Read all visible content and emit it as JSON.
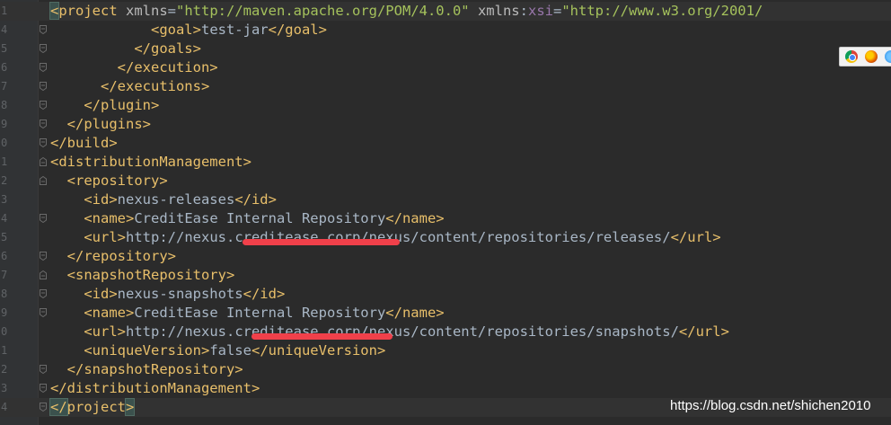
{
  "editor": {
    "lines": [
      {
        "num": "1",
        "parts": [
          {
            "t": "<",
            "c": "tag bm"
          },
          {
            "t": "project",
            "c": "tag"
          },
          {
            "t": " xmlns",
            "c": "attr"
          },
          {
            "t": "=",
            "c": "txt"
          },
          {
            "t": "\"http://maven.apache.org/POM/4.0.0\"",
            "c": "val"
          },
          {
            "t": " xmlns",
            "c": "attr"
          },
          {
            "t": ":",
            "c": "txt"
          },
          {
            "t": "xsi",
            "c": "ns"
          },
          {
            "t": "=",
            "c": "txt"
          },
          {
            "t": "\"http://www.w3.org/2001/",
            "c": "val"
          }
        ]
      },
      {
        "num": "4",
        "parts": [
          {
            "t": "            <goal>",
            "c": "tag"
          },
          {
            "t": "test-jar",
            "c": "txt"
          },
          {
            "t": "</goal>",
            "c": "tag"
          }
        ]
      },
      {
        "num": "5",
        "parts": [
          {
            "t": "          </goals>",
            "c": "tag"
          }
        ]
      },
      {
        "num": "6",
        "parts": [
          {
            "t": "        </execution>",
            "c": "tag"
          }
        ]
      },
      {
        "num": "7",
        "parts": [
          {
            "t": "      </executions>",
            "c": "tag"
          }
        ]
      },
      {
        "num": "8",
        "parts": [
          {
            "t": "    </plugin>",
            "c": "tag"
          }
        ]
      },
      {
        "num": "9",
        "parts": [
          {
            "t": "  </plugins>",
            "c": "tag"
          }
        ]
      },
      {
        "num": "0",
        "parts": [
          {
            "t": "</build>",
            "c": "tag"
          }
        ]
      },
      {
        "num": "1",
        "parts": [
          {
            "t": "<distributionManagement>",
            "c": "tag"
          }
        ]
      },
      {
        "num": "2",
        "parts": [
          {
            "t": "  <repository>",
            "c": "tag"
          }
        ]
      },
      {
        "num": "3",
        "parts": [
          {
            "t": "    <id>",
            "c": "tag"
          },
          {
            "t": "nexus-releases",
            "c": "txt"
          },
          {
            "t": "</id>",
            "c": "tag"
          }
        ]
      },
      {
        "num": "4",
        "parts": [
          {
            "t": "    <name>",
            "c": "tag"
          },
          {
            "t": "CreditEase Internal Repository",
            "c": "txt"
          },
          {
            "t": "</name>",
            "c": "tag"
          }
        ]
      },
      {
        "num": "5",
        "parts": [
          {
            "t": "    <url>",
            "c": "tag"
          },
          {
            "t": "http://nexus.creditease.corp/nexus/content/repositories/releases/",
            "c": "txt"
          },
          {
            "t": "</url>",
            "c": "tag"
          }
        ]
      },
      {
        "num": "6",
        "parts": [
          {
            "t": "  </repository>",
            "c": "tag"
          }
        ]
      },
      {
        "num": "7",
        "parts": [
          {
            "t": "  <snapshotRepository>",
            "c": "tag"
          }
        ]
      },
      {
        "num": "8",
        "parts": [
          {
            "t": "    <id>",
            "c": "tag"
          },
          {
            "t": "nexus-snapshots",
            "c": "txt"
          },
          {
            "t": "</id>",
            "c": "tag"
          }
        ]
      },
      {
        "num": "9",
        "parts": [
          {
            "t": "    <name>",
            "c": "tag"
          },
          {
            "t": "CreditEase Internal Repository",
            "c": "txt"
          },
          {
            "t": "</name>",
            "c": "tag"
          }
        ]
      },
      {
        "num": "0",
        "parts": [
          {
            "t": "    <url>",
            "c": "tag"
          },
          {
            "t": "http://nexus.creditease.corp/nexus/content/repositories/snapshots/",
            "c": "txt"
          },
          {
            "t": "</url>",
            "c": "tag"
          }
        ]
      },
      {
        "num": "1",
        "parts": [
          {
            "t": "    <uniqueVersion>",
            "c": "tag"
          },
          {
            "t": "false",
            "c": "txt"
          },
          {
            "t": "</uniqueVersion>",
            "c": "tag"
          }
        ]
      },
      {
        "num": "2",
        "parts": [
          {
            "t": "  </snapshotRepository>",
            "c": "tag"
          }
        ]
      },
      {
        "num": "3",
        "parts": [
          {
            "t": "</distributionManagement>",
            "c": "tag"
          }
        ]
      },
      {
        "num": "4",
        "parts": [
          {
            "t": "</",
            "c": "tag bm"
          },
          {
            "t": "project",
            "c": "tag"
          },
          {
            "t": ">",
            "c": "tag bm"
          }
        ]
      }
    ]
  },
  "browser_icons": [
    "chrome-icon",
    "firefox-icon",
    "safari-icon"
  ],
  "watermark": "https://blog.csdn.net/shichen2010"
}
